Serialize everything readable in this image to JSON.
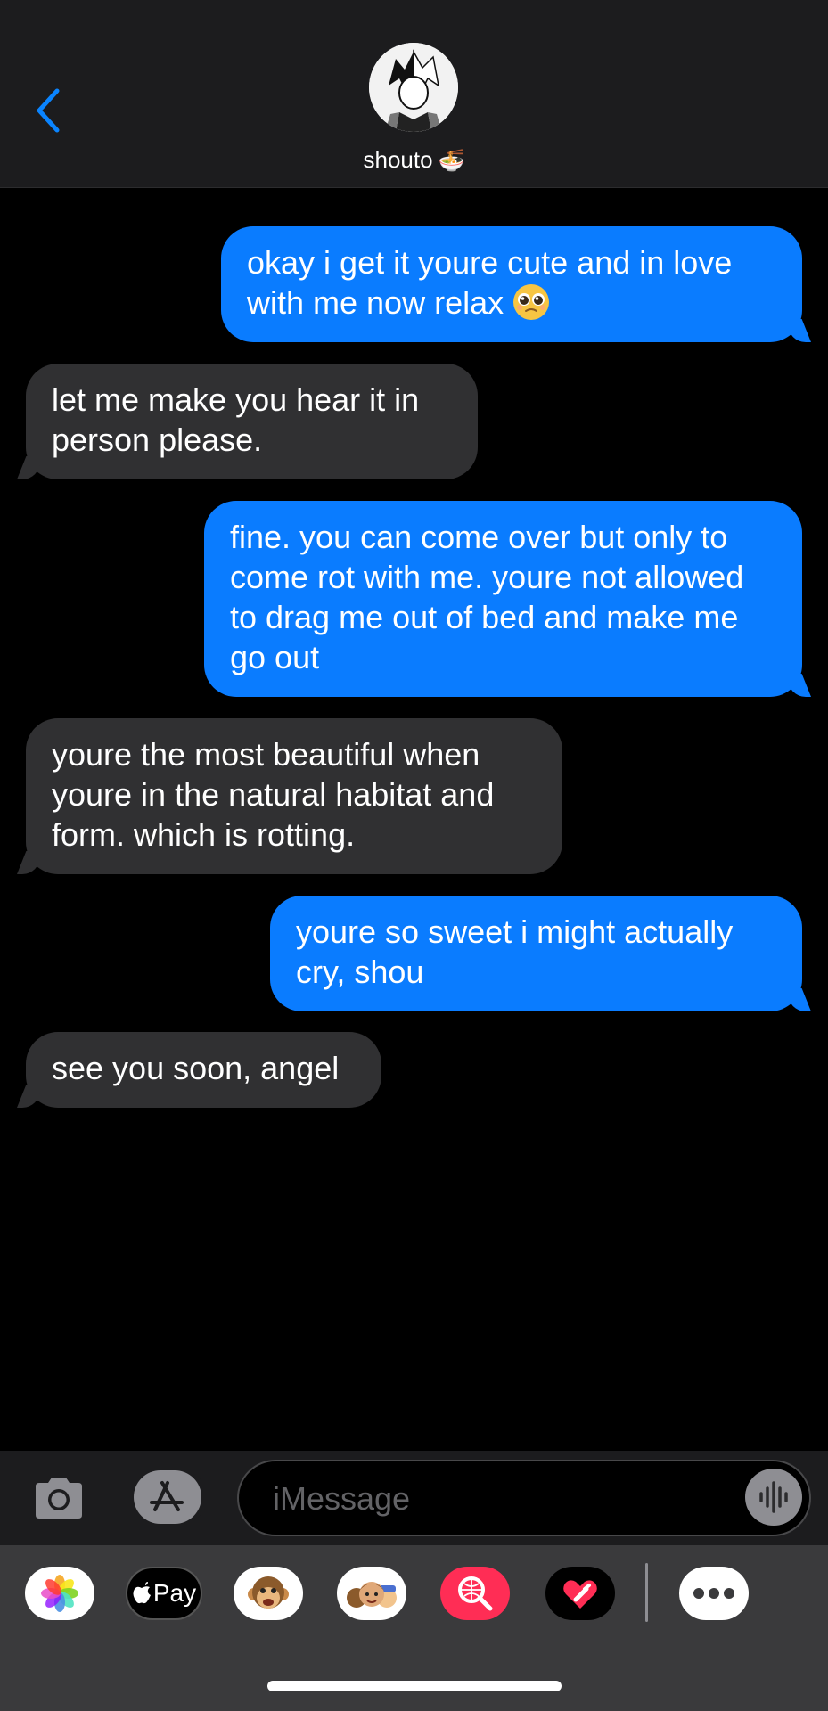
{
  "header": {
    "contact_name": "shouto",
    "contact_emoji": "🍜"
  },
  "messages": [
    {
      "from": "me",
      "text": "okay i get it youre cute and in love with me now relax",
      "emoji": "🥹"
    },
    {
      "from": "them",
      "text": "let me make you hear it in person please."
    },
    {
      "from": "me",
      "text": "fine. you can come over but only to come rot with me. youre not allowed to drag me out of bed and make me go out"
    },
    {
      "from": "them",
      "text": "youre the most beautiful when youre in the natural habitat and form. which is rotting."
    },
    {
      "from": "me",
      "text": "youre so sweet i might actually cry, shou"
    },
    {
      "from": "them",
      "text": "see you soon, angel"
    }
  ],
  "input": {
    "placeholder": "iMessage",
    "value": ""
  },
  "apps": {
    "apple_pay_label": "Pay",
    "items": [
      "photos-icon",
      "apple-pay-icon",
      "animoji-icon",
      "memoji-stickers-icon",
      "images-search-icon",
      "digital-touch-icon",
      "more-icon"
    ]
  },
  "colors": {
    "sent_bubble": "#0a7cff",
    "received_bubble": "#303032",
    "accent": "#0a84ff",
    "background": "#000000"
  }
}
